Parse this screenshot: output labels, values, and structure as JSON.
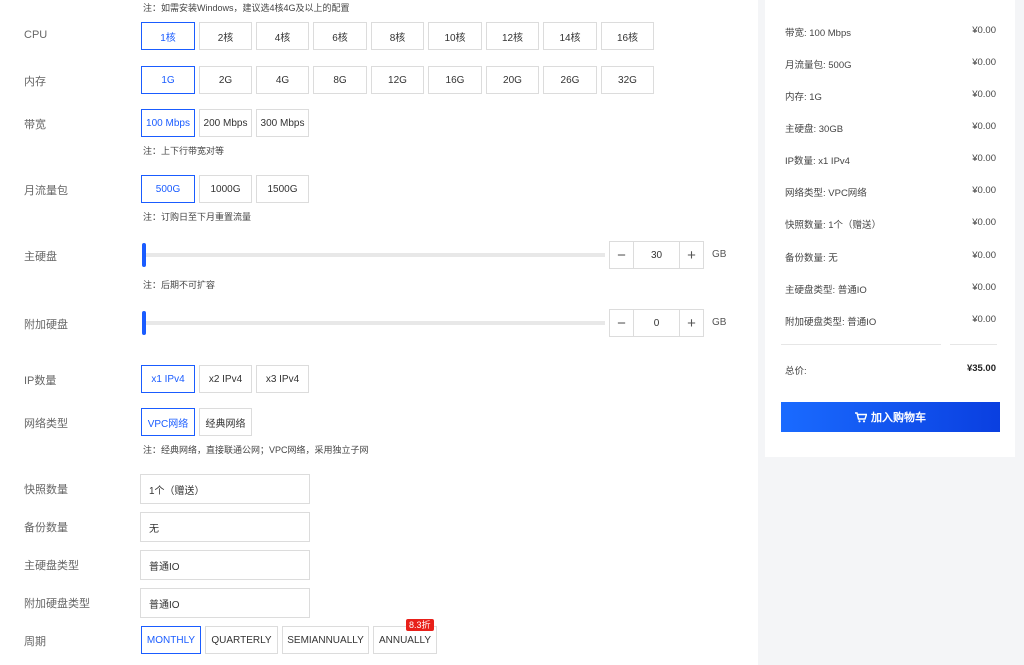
{
  "notes": {
    "windows": "注：如需安装Windows，建议选4核4G及以上的配置",
    "bandwidth": "注：上下行带宽对等",
    "traffic": "注：订购日至下月重置流量",
    "disk": "注：后期不可扩容",
    "network": "注：经典网络，直接联通公网；VPC网络，采用独立子网"
  },
  "labels": {
    "cpu": "CPU",
    "memory": "内存",
    "bandwidth": "带宽",
    "traffic": "月流量包",
    "main_disk": "主硬盘",
    "extra_disk": "附加硬盘",
    "ip": "IP数量",
    "network": "网络类型",
    "snapshot": "快照数量",
    "backup": "备份数量",
    "main_disk_type": "主硬盘类型",
    "extra_disk_type": "附加硬盘类型",
    "period": "周期"
  },
  "cpu_options": [
    "1核",
    "2核",
    "4核",
    "6核",
    "8核",
    "10核",
    "12核",
    "14核",
    "16核"
  ],
  "memory_options": [
    "1G",
    "2G",
    "4G",
    "8G",
    "12G",
    "16G",
    "20G",
    "26G",
    "32G"
  ],
  "bandwidth_options": [
    "100 Mbps",
    "200 Mbps",
    "300 Mbps"
  ],
  "traffic_options": [
    "500G",
    "1000G",
    "1500G"
  ],
  "ip_options": [
    "x1 IPv4",
    "x2 IPv4",
    "x3 IPv4"
  ],
  "network_options": [
    "VPC网络",
    "经典网络"
  ],
  "period_options": [
    "MONTHLY",
    "QUARTERLY",
    "SEMIANNUALLY",
    "ANNUALLY"
  ],
  "selected": {
    "cpu": "1核",
    "memory": "1G",
    "bandwidth": "100 Mbps",
    "traffic": "500G",
    "ip": "x1 IPv4",
    "network": "VPC网络",
    "period": "MONTHLY"
  },
  "main_disk": {
    "value": "30",
    "unit": "GB",
    "minus": "−",
    "plus": "+",
    "slider_fraction": 0
  },
  "extra_disk": {
    "value": "0",
    "unit": "GB",
    "minus": "−",
    "plus": "+",
    "slider_fraction": 0
  },
  "fields": {
    "snapshot": "1个（赠送）",
    "backup": "无",
    "main_disk_type": "普通IO",
    "extra_disk_type": "普通IO"
  },
  "discount_badge": "8.3折",
  "summary": {
    "rows": [
      {
        "label": "带宽: 100 Mbps",
        "price": "¥0.00"
      },
      {
        "label": "月流量包: 500G",
        "price": "¥0.00"
      },
      {
        "label": "内存: 1G",
        "price": "¥0.00"
      },
      {
        "label": "主硬盘: 30GB",
        "price": "¥0.00"
      },
      {
        "label": "IP数量: x1 IPv4",
        "price": "¥0.00"
      },
      {
        "label": "网络类型: VPC网络",
        "price": "¥0.00"
      },
      {
        "label": "快照数量: 1个（赠送）",
        "price": "¥0.00"
      },
      {
        "label": "备份数量: 无",
        "price": "¥0.00"
      },
      {
        "label": "主硬盘类型: 普通IO",
        "price": "¥0.00"
      },
      {
        "label": "附加硬盘类型: 普通IO",
        "price": "¥0.00"
      }
    ],
    "total_label": "总价:",
    "total_value": "¥35.00",
    "cart_button": "加入购物车"
  },
  "colors": {
    "accent": "#1a5cff",
    "badge": "#e8201a"
  }
}
